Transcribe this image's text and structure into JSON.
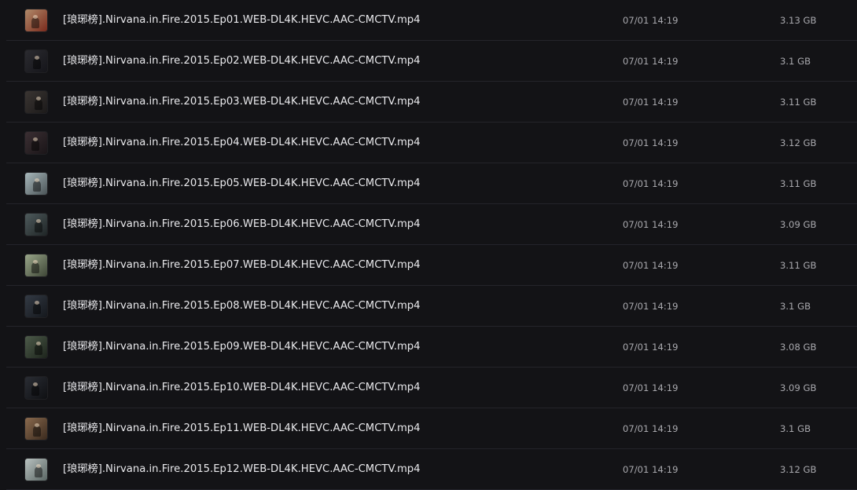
{
  "files": [
    {
      "name": "[琅琊榜].Nirvana.in.Fire.2015.Ep01.WEB-DL4K.HEVC.AAC-CMCTV.mp4",
      "date": "07/01 14:19",
      "size": "3.13 GB",
      "thumb_icon": "video-thumbnail-icon",
      "thumb_colors": [
        "#b08a6a",
        "#7a2a1c"
      ]
    },
    {
      "name": "[琅琊榜].Nirvana.in.Fire.2015.Ep02.WEB-DL4K.HEVC.AAC-CMCTV.mp4",
      "date": "07/01 14:19",
      "size": "3.1 GB",
      "thumb_icon": "video-thumbnail-icon",
      "thumb_colors": [
        "#2b2b30",
        "#15151a"
      ]
    },
    {
      "name": "[琅琊榜].Nirvana.in.Fire.2015.Ep03.WEB-DL4K.HEVC.AAC-CMCTV.mp4",
      "date": "07/01 14:19",
      "size": "3.11 GB",
      "thumb_icon": "video-thumbnail-icon",
      "thumb_colors": [
        "#3a3532",
        "#1c1a1a"
      ]
    },
    {
      "name": "[琅琊榜].Nirvana.in.Fire.2015.Ep04.WEB-DL4K.HEVC.AAC-CMCTV.mp4",
      "date": "07/01 14:19",
      "size": "3.12 GB",
      "thumb_icon": "video-thumbnail-icon",
      "thumb_colors": [
        "#3b2f33",
        "#1a1518"
      ]
    },
    {
      "name": "[琅琊榜].Nirvana.in.Fire.2015.Ep05.WEB-DL4K.HEVC.AAC-CMCTV.mp4",
      "date": "07/01 14:19",
      "size": "3.11 GB",
      "thumb_icon": "video-thumbnail-icon",
      "thumb_colors": [
        "#a8b8bc",
        "#4a5356"
      ]
    },
    {
      "name": "[琅琊榜].Nirvana.in.Fire.2015.Ep06.WEB-DL4K.HEVC.AAC-CMCTV.mp4",
      "date": "07/01 14:19",
      "size": "3.09 GB",
      "thumb_icon": "video-thumbnail-icon",
      "thumb_colors": [
        "#4e5a5c",
        "#1f2526"
      ]
    },
    {
      "name": "[琅琊榜].Nirvana.in.Fire.2015.Ep07.WEB-DL4K.HEVC.AAC-CMCTV.mp4",
      "date": "07/01 14:19",
      "size": "3.11 GB",
      "thumb_icon": "video-thumbnail-icon",
      "thumb_colors": [
        "#9aa78a",
        "#3e4636"
      ]
    },
    {
      "name": "[琅琊榜].Nirvana.in.Fire.2015.Ep08.WEB-DL4K.HEVC.AAC-CMCTV.mp4",
      "date": "07/01 14:19",
      "size": "3.1 GB",
      "thumb_icon": "video-thumbnail-icon",
      "thumb_colors": [
        "#333a44",
        "#15181d"
      ]
    },
    {
      "name": "[琅琊榜].Nirvana.in.Fire.2015.Ep09.WEB-DL4K.HEVC.AAC-CMCTV.mp4",
      "date": "07/01 14:19",
      "size": "3.08 GB",
      "thumb_icon": "video-thumbnail-icon",
      "thumb_colors": [
        "#4d5b4a",
        "#1d241c"
      ]
    },
    {
      "name": "[琅琊榜].Nirvana.in.Fire.2015.Ep10.WEB-DL4K.HEVC.AAC-CMCTV.mp4",
      "date": "07/01 14:19",
      "size": "3.09 GB",
      "thumb_icon": "video-thumbnail-icon",
      "thumb_colors": [
        "#2a2d34",
        "#0f1013"
      ]
    },
    {
      "name": "[琅琊榜].Nirvana.in.Fire.2015.Ep11.WEB-DL4K.HEVC.AAC-CMCTV.mp4",
      "date": "07/01 14:19",
      "size": "3.1 GB",
      "thumb_icon": "video-thumbnail-icon",
      "thumb_colors": [
        "#8a6a4e",
        "#3a2a1e"
      ]
    },
    {
      "name": "[琅琊榜].Nirvana.in.Fire.2015.Ep12.WEB-DL4K.HEVC.AAC-CMCTV.mp4",
      "date": "07/01 14:19",
      "size": "3.12 GB",
      "thumb_icon": "video-thumbnail-icon",
      "thumb_colors": [
        "#b9c2c0",
        "#5a6664"
      ]
    }
  ]
}
